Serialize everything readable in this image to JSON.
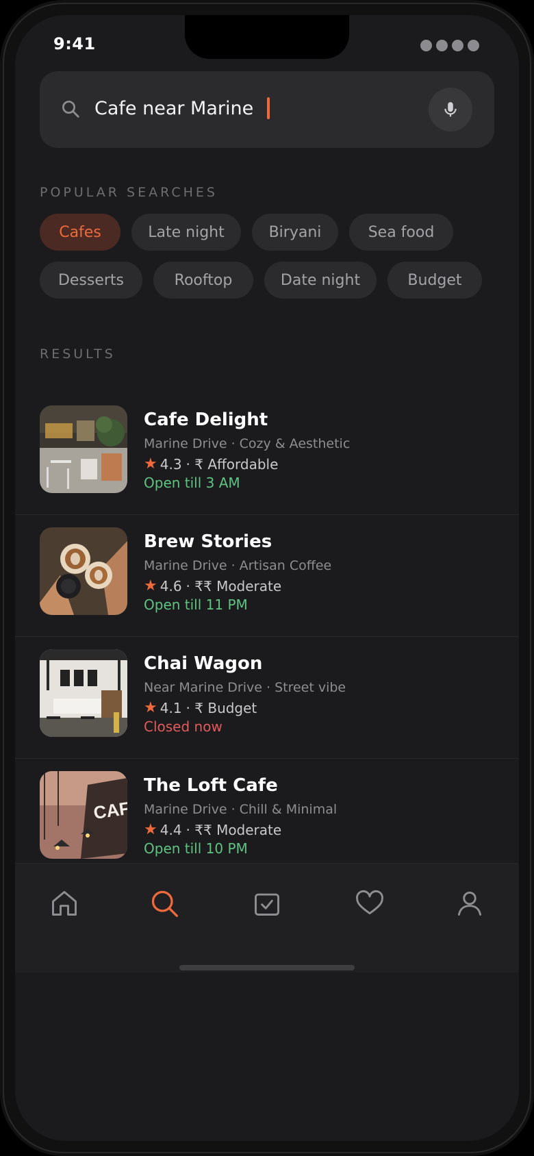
{
  "status_bar": {
    "time": "9:41"
  },
  "search": {
    "query": "Cafe near Marine",
    "icon": "search-icon",
    "mic_icon": "microphone-icon"
  },
  "popular": {
    "label": "POPULAR SEARCHES",
    "chips": [
      {
        "label": "Cafes",
        "active": true
      },
      {
        "label": "Late night",
        "active": false
      },
      {
        "label": "Biryani",
        "active": false
      },
      {
        "label": "Sea food",
        "active": false
      },
      {
        "label": "Desserts",
        "active": false
      },
      {
        "label": "Rooftop",
        "active": false
      },
      {
        "label": "Date night",
        "active": false
      },
      {
        "label": "Budget",
        "active": false
      }
    ]
  },
  "results": {
    "label": "RESULTS",
    "items": [
      {
        "name": "Cafe Delight",
        "subtitle": "Marine Drive · Cozy & Aesthetic",
        "rating": "4.3",
        "price": "· ₹ Affordable",
        "status": "Open till 3 AM",
        "status_type": "open"
      },
      {
        "name": "Brew Stories",
        "subtitle": "Marine Drive · Artisan Coffee",
        "rating": "4.6",
        "price": "· ₹₹ Moderate",
        "status": "Open till 11 PM",
        "status_type": "open"
      },
      {
        "name": "Chai Wagon",
        "subtitle": "Near Marine Drive · Street vibe",
        "rating": "4.1",
        "price": "· ₹ Budget",
        "status": "Closed now",
        "status_type": "closed"
      },
      {
        "name": "The Loft Cafe",
        "subtitle": "Marine Drive · Chill & Minimal",
        "rating": "4.4",
        "price": "· ₹₹ Moderate",
        "status": "Open till 10 PM",
        "status_type": "open"
      }
    ]
  },
  "tab_bar": {
    "tabs": [
      {
        "icon": "home-icon",
        "active": false
      },
      {
        "icon": "search-icon",
        "active": true
      },
      {
        "icon": "bookings-icon",
        "active": false
      },
      {
        "icon": "heart-icon",
        "active": false
      },
      {
        "icon": "profile-icon",
        "active": false
      }
    ]
  },
  "colors": {
    "accent": "#ee6a3c",
    "open": "#5fc482",
    "closed": "#e25a5a",
    "background": "#1b1b1d"
  }
}
